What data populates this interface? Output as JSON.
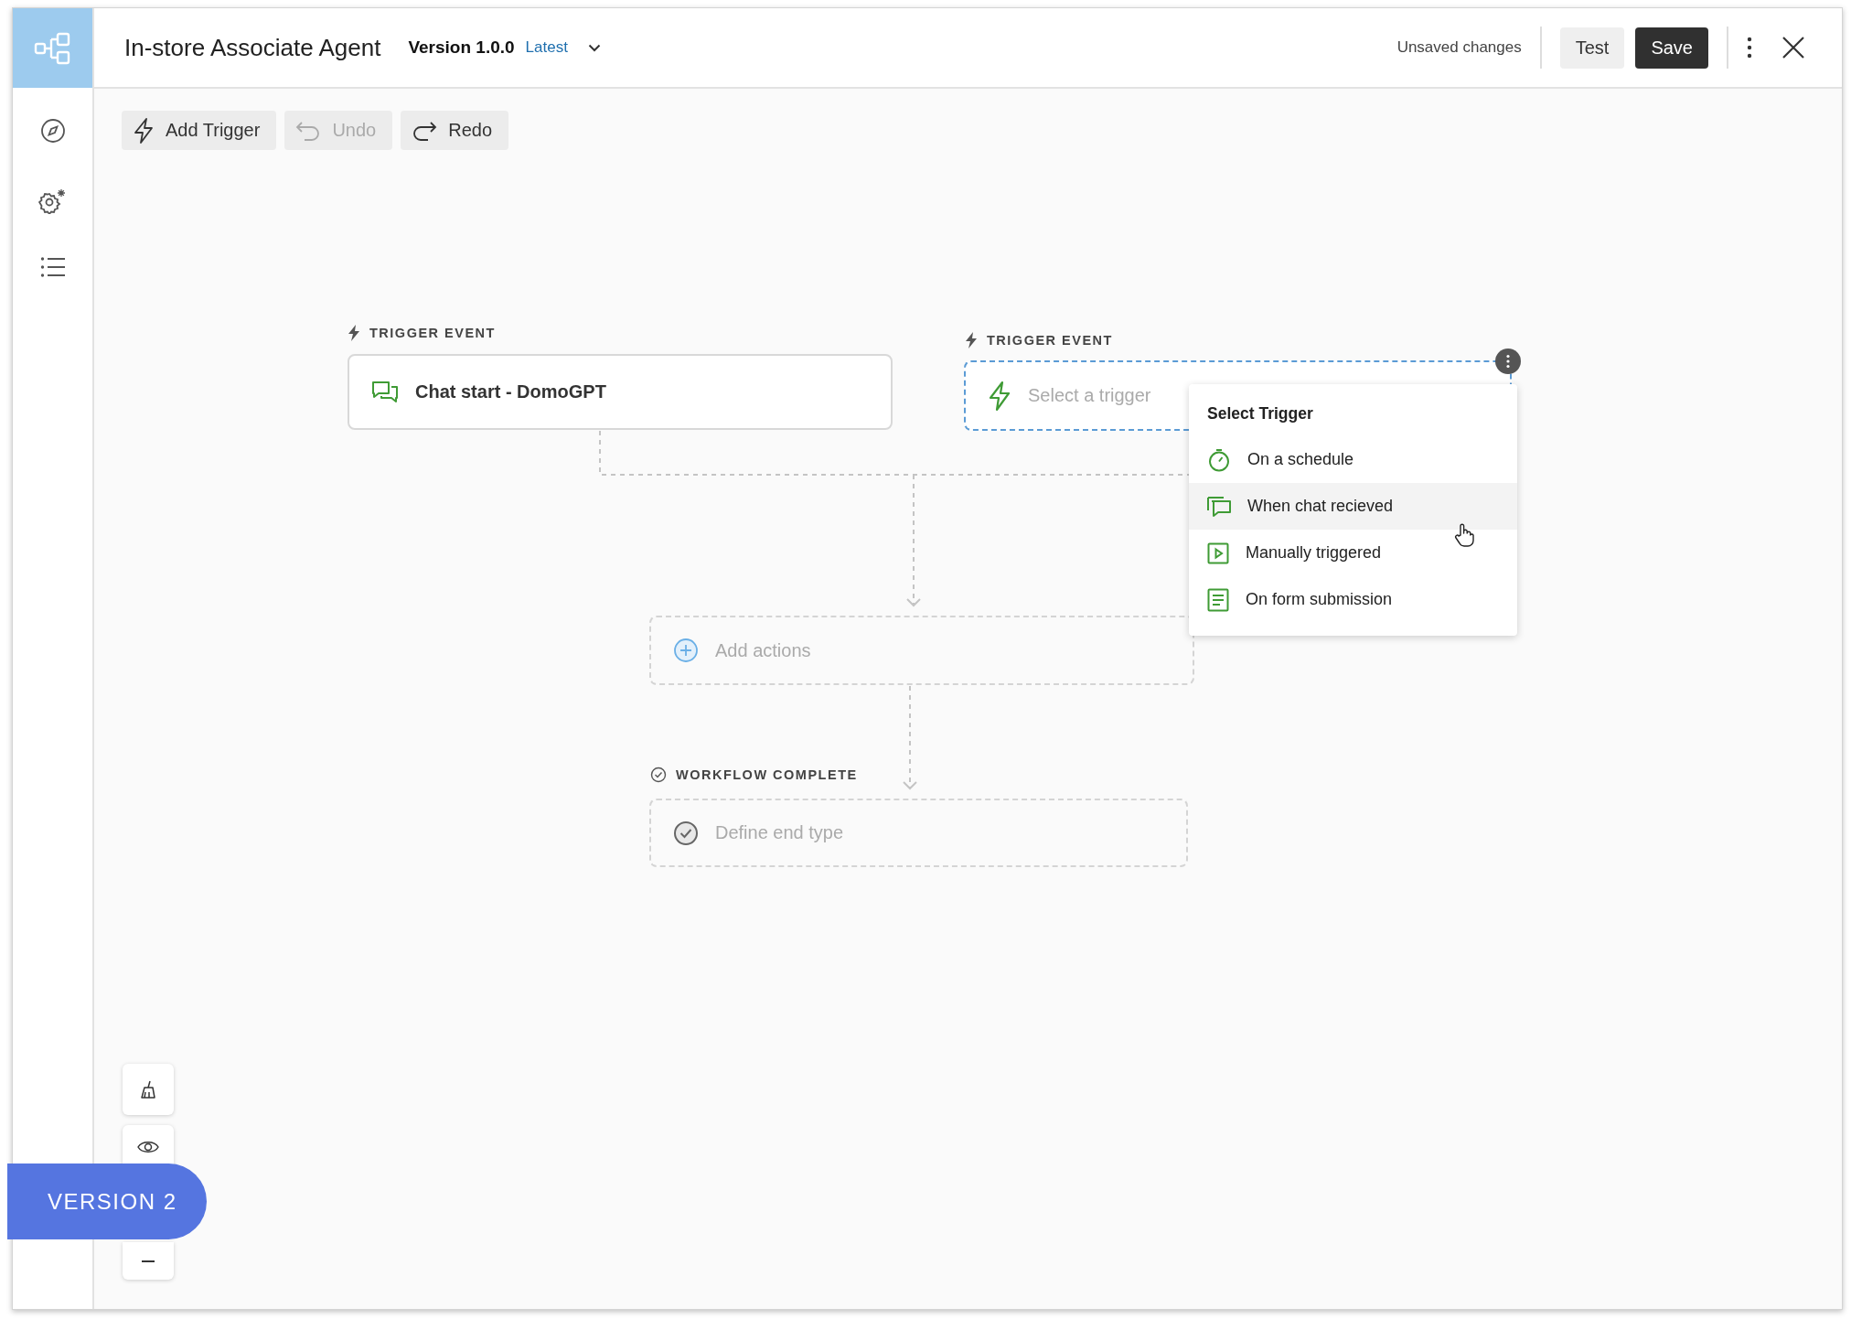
{
  "header": {
    "title": "In-store Associate Agent",
    "version": "Version 1.0.0",
    "version_tag": "Latest",
    "status": "Unsaved changes",
    "buttons": [
      {
        "label": "Test",
        "kind": "secondary"
      },
      {
        "label": "Save",
        "kind": "primary"
      }
    ]
  },
  "toolbar": [
    {
      "label": "Add Trigger",
      "kind": "trigger",
      "disabled": false
    },
    {
      "label": "Undo",
      "kind": "undo",
      "disabled": true
    },
    {
      "label": "Redo",
      "kind": "redo",
      "disabled": false
    }
  ],
  "triggers": [
    {
      "label": "TRIGGER EVENT",
      "text": "Chat start - DomoGPT",
      "selected": false
    },
    {
      "label": "TRIGGER EVENT",
      "placeholder": "Select a trigger",
      "selected": true
    }
  ],
  "actions": {
    "placeholder": "Add actions"
  },
  "end": {
    "label": "WORKFLOW COMPLETE",
    "placeholder": "Define end type"
  },
  "menu": {
    "title": "Select Trigger",
    "items": [
      {
        "label": "On a schedule",
        "kind": "timer",
        "selected": false
      },
      {
        "label": "When chat recieved",
        "kind": "chat",
        "selected": true
      },
      {
        "label": "Manually triggered",
        "kind": "play",
        "selected": false
      },
      {
        "label": "On form submission",
        "kind": "form",
        "selected": false
      }
    ]
  },
  "badge": {
    "text": "VERSION 2"
  }
}
